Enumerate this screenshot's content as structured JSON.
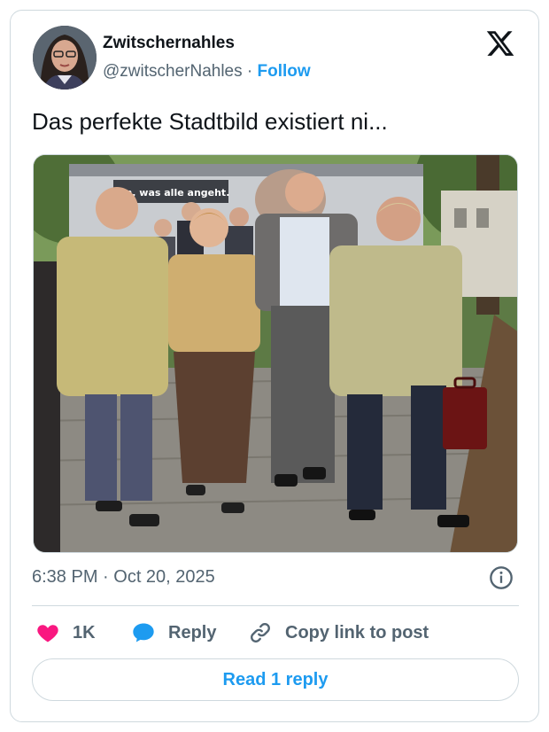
{
  "author": {
    "display_name": "Zwitschernahles",
    "handle": "@zwitscherNahles",
    "separator": " · ",
    "follow_label": "Follow"
  },
  "tweet": {
    "text": "Das perfekte Stadtbild existiert ni...",
    "media_caption": "en, was alle angeht.",
    "timestamp": "6:38 PM · Oct 20, 2025"
  },
  "actions": {
    "likes": "1K",
    "reply_label": "Reply",
    "copy_label": "Copy link to post"
  },
  "footer": {
    "read_replies_label": "Read 1 reply"
  },
  "colors": {
    "accent": "#1d9bf0",
    "like": "#f91880",
    "muted": "#536471",
    "border": "#cfd9de"
  },
  "icons": [
    "x-logo-icon",
    "info-icon",
    "heart-icon",
    "reply-bubble-icon",
    "link-icon"
  ]
}
